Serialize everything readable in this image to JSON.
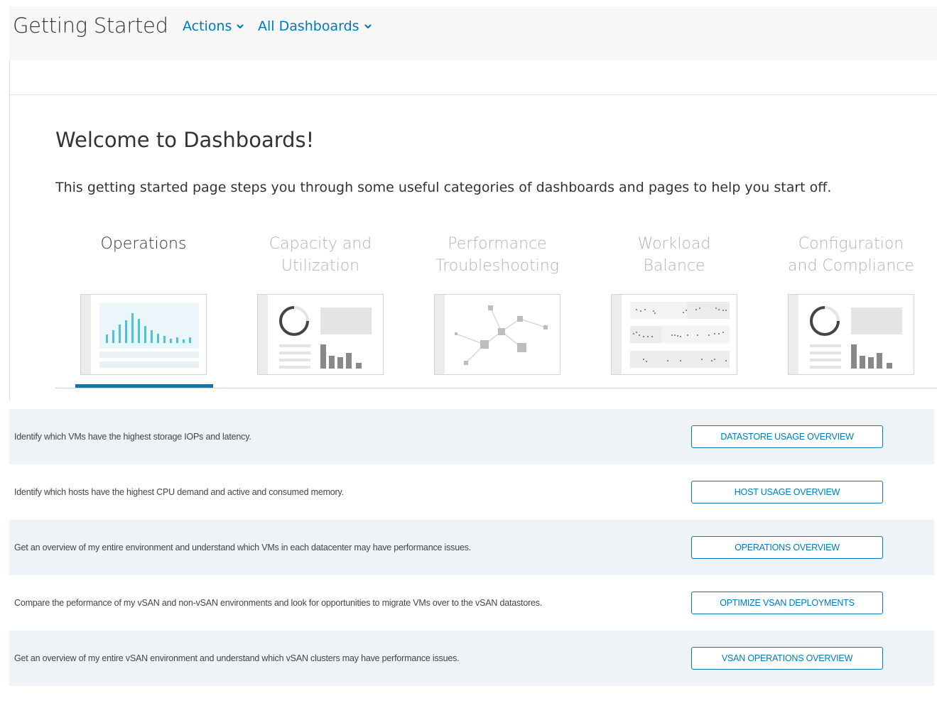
{
  "header": {
    "title": "Getting Started",
    "menus": [
      {
        "label": "Actions",
        "icon": "chevron-down-icon"
      },
      {
        "label": "All Dashboards",
        "icon": "chevron-down-icon"
      }
    ]
  },
  "welcome": {
    "title": "Welcome to Dashboards!",
    "text": "This getting started page steps you through some useful categories of dashboards and pages to help you start off."
  },
  "categories": [
    {
      "line1": "Operations",
      "line2": "",
      "active": true
    },
    {
      "line1": "Capacity and",
      "line2": "Utilization",
      "active": false
    },
    {
      "line1": "Performance",
      "line2": "Troubleshooting",
      "active": false
    },
    {
      "line1": "Workload",
      "line2": "Balance",
      "active": false
    },
    {
      "line1": "Configuration",
      "line2": "and Compliance",
      "active": false
    }
  ],
  "rows": [
    {
      "description": "Identify which VMs have the highest storage IOPs and latency.",
      "button": "DATASTORE USAGE OVERVIEW"
    },
    {
      "description": "Identify which hosts have the highest CPU demand and active and consumed memory.",
      "button": "HOST USAGE OVERVIEW"
    },
    {
      "description": "Get an overview of my entire environment and understand which VMs in each datacenter may have performance issues.",
      "button": "OPERATIONS OVERVIEW"
    },
    {
      "description": "Compare the peformance of my vSAN and non-vSAN environments and look for opportunities to migrate VMs over to the vSAN datastores.",
      "button": "OPTIMIZE VSAN DEPLOYMENTS"
    },
    {
      "description": "Get an overview of my entire vSAN environment and understand which vSAN clusters may have performance issues.",
      "button": "VSAN OPERATIONS OVERVIEW"
    }
  ],
  "colors": {
    "accent": "#0079b8",
    "row_shade": "#eef3f8",
    "chart_bar": "#4ec3d6"
  }
}
